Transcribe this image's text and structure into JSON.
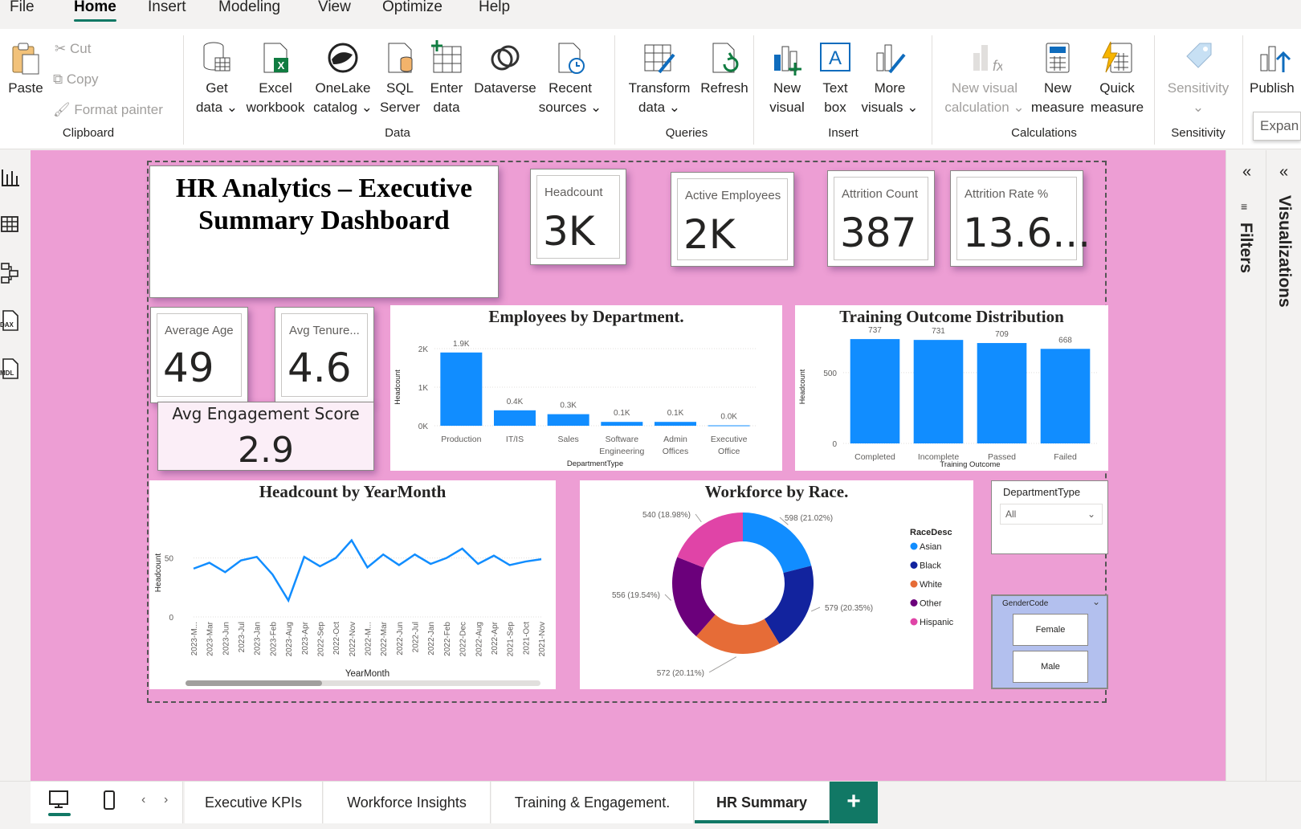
{
  "menu": [
    "File",
    "Home",
    "Insert",
    "Modeling",
    "View",
    "Optimize",
    "Help"
  ],
  "ribbon": {
    "clipboard": {
      "paste": "Paste",
      "cut": "Cut",
      "copy": "Copy",
      "format_painter": "Format painter",
      "label": "Clipboard"
    },
    "data": {
      "get_data": [
        "Get",
        "data"
      ],
      "excel": [
        "Excel",
        "workbook"
      ],
      "onelake": [
        "OneLake",
        "catalog"
      ],
      "sql": [
        "SQL",
        "Server"
      ],
      "enter": [
        "Enter",
        "data"
      ],
      "dataverse": "Dataverse",
      "recent": [
        "Recent",
        "sources"
      ],
      "label": "Data"
    },
    "queries": {
      "transform": [
        "Transform",
        "data"
      ],
      "refresh": "Refresh",
      "label": "Queries"
    },
    "insert": {
      "new_visual": [
        "New",
        "visual"
      ],
      "text_box": [
        "Text",
        "box"
      ],
      "more_visuals": [
        "More",
        "visuals"
      ],
      "label": "Insert"
    },
    "calculations": {
      "new_visual_calc": [
        "New visual",
        "calculation"
      ],
      "new_measure": [
        "New",
        "measure"
      ],
      "quick_measure": [
        "Quick",
        "measure"
      ],
      "label": "Calculations"
    },
    "sensitivity": {
      "btn": "Sensitivity",
      "label": "Sensitivity"
    },
    "share": {
      "publish": "Publish",
      "expand": "Expan"
    }
  },
  "report": {
    "title": "HR Analytics – Executive Summary Dashboard",
    "kpis": {
      "headcount": {
        "label": "Headcount",
        "value": "3K"
      },
      "active": {
        "label": "Active Employees",
        "value": "2K"
      },
      "attrition_count": {
        "label": "Attrition Count",
        "value": "387"
      },
      "attrition_rate": {
        "label": "Attrition Rate %",
        "value": "13.6..."
      },
      "avg_age": {
        "label": "Average Age",
        "value": "49"
      },
      "avg_tenure": {
        "label": "Avg Tenure...",
        "value": "4.6"
      },
      "avg_engagement": {
        "label": "Avg Engagement Score",
        "value": "2.9"
      }
    },
    "slicers": {
      "department": {
        "title": "DepartmentType",
        "selected": "All"
      },
      "gender": {
        "title": "GenderCode",
        "options": [
          "Female",
          "Male"
        ]
      }
    }
  },
  "chart_data": [
    {
      "id": "dept",
      "type": "bar",
      "title": "Employees by Department.",
      "xlabel": "DepartmentType",
      "ylabel": "Headcount",
      "categories": [
        [
          "Production"
        ],
        [
          "IT/IS"
        ],
        [
          "Sales"
        ],
        [
          "Software",
          "Engineering"
        ],
        [
          "Admin",
          "Offices"
        ],
        [
          "Executive",
          "Office"
        ]
      ],
      "values": [
        1900,
        400,
        300,
        100,
        100,
        10
      ],
      "data_labels": [
        "1.9K",
        "0.4K",
        "0.3K",
        "0.1K",
        "0.1K",
        "0.0K"
      ],
      "yticks": [
        "0K",
        "1K",
        "2K"
      ],
      "ylim": [
        0,
        2000
      ],
      "color": "#118dff"
    },
    {
      "id": "training",
      "type": "bar",
      "title": "Training Outcome Distribution",
      "xlabel": "Training Outcome",
      "ylabel": "Headcount",
      "categories": [
        [
          "Completed"
        ],
        [
          "Incomplete"
        ],
        [
          "Passed"
        ],
        [
          "Failed"
        ]
      ],
      "values": [
        737,
        731,
        709,
        668
      ],
      "data_labels": [
        "737",
        "731",
        "709",
        "668"
      ],
      "yticks": [
        "0",
        "500"
      ],
      "ylim": [
        0,
        800
      ],
      "color": "#118dff"
    },
    {
      "id": "yearmonth",
      "type": "line",
      "title": "Headcount by YearMonth",
      "xlabel": "YearMonth",
      "ylabel": "Headcount",
      "x": [
        "2023-M...",
        "2023-Mar",
        "2023-Jun",
        "2023-Jul",
        "2023-Jan",
        "2023-Feb",
        "2023-Aug",
        "2023-Apr",
        "2022-Sep",
        "2022-Oct",
        "2022-Nov",
        "2022-M...",
        "2022-Mar",
        "2022-Jun",
        "2022-Jul",
        "2022-Jan",
        "2022-Feb",
        "2022-Dec",
        "2022-Aug",
        "2022-Apr",
        "2021-Sep",
        "2021-Oct",
        "2021-Nov"
      ],
      "values": [
        41,
        46,
        38,
        48,
        51,
        36,
        14,
        51,
        43,
        50,
        65,
        42,
        53,
        44,
        53,
        45,
        50,
        58,
        45,
        52,
        44,
        47,
        49
      ],
      "yticks": [
        "0",
        "50"
      ],
      "ylim": [
        0,
        75
      ],
      "color": "#118dff"
    },
    {
      "id": "race",
      "type": "pie",
      "title": "Workforce by Race.",
      "legend_title": "RaceDesc",
      "labels": [
        "Asian",
        "Black",
        "White",
        "Other",
        "Hispanic"
      ],
      "values": [
        598,
        579,
        572,
        556,
        540
      ],
      "data_labels": [
        "598 (21.02%)",
        "579 (20.35%)",
        "572 (20.11%)",
        "556 (19.54%)",
        "540 (18.98%)"
      ],
      "colors": [
        "#118dff",
        "#12239e",
        "#e66c37",
        "#6b007b",
        "#e044a7"
      ]
    }
  ],
  "pane": {
    "filters": "Filters",
    "visualizations": "Visualizations"
  },
  "tabs": [
    "Executive KPIs",
    "Workforce Insights",
    "Training & Engagement.",
    "HR Summary"
  ]
}
